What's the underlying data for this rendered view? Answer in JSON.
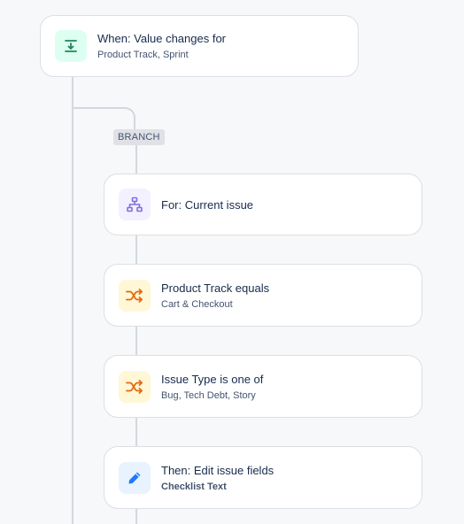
{
  "trigger": {
    "title": "When: Value changes for",
    "subtitle": "Product Track, Sprint",
    "icon": "field-value-changed-icon",
    "icon_bg": "#dcfff1",
    "icon_color": "#1f845a"
  },
  "branch": {
    "label": "BRANCH"
  },
  "steps": [
    {
      "title": "For: Current issue",
      "subtitle": "",
      "icon": "branch-hierarchy-icon",
      "icon_bg": "#f3f0ff",
      "icon_color": "#8270db"
    },
    {
      "title": "Product Track equals",
      "subtitle": "Cart & Checkout",
      "icon": "shuffle-condition-icon",
      "icon_bg": "#fff7d6",
      "icon_color": "#e56910"
    },
    {
      "title": "Issue Type is one of",
      "subtitle": "Bug, Tech Debt, Story",
      "icon": "shuffle-condition-icon",
      "icon_bg": "#fff7d6",
      "icon_color": "#e56910"
    },
    {
      "title": "Then: Edit issue fields",
      "subtitle": "Checklist Text",
      "icon": "pencil-edit-icon",
      "icon_bg": "#e9f2ff",
      "icon_color": "#1d7afc"
    }
  ]
}
